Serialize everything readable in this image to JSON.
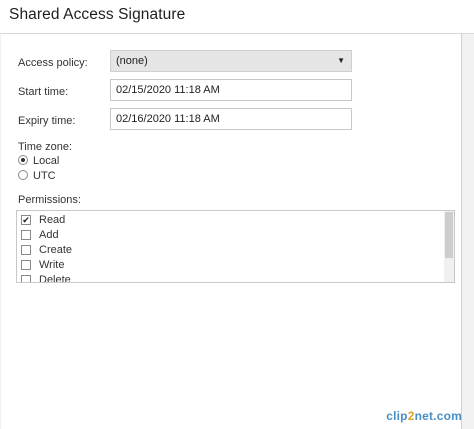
{
  "title": "Shared Access Signature",
  "form": {
    "access_policy_label": "Access policy:",
    "access_policy_value": "(none)",
    "start_time_label": "Start time:",
    "start_time_value": "02/15/2020 11:18  AM",
    "expiry_time_label": "Expiry time:",
    "expiry_time_value": "02/16/2020 11:18  AM",
    "time_zone_label": "Time zone:",
    "time_zone_options": [
      {
        "label": "Local",
        "selected": true
      },
      {
        "label": "UTC",
        "selected": false
      }
    ],
    "permissions_label": "Permissions:",
    "permissions": [
      {
        "label": "Read",
        "checked": true
      },
      {
        "label": "Add",
        "checked": false
      },
      {
        "label": "Create",
        "checked": false
      },
      {
        "label": "Write",
        "checked": false
      },
      {
        "label": "Delete",
        "checked": false
      }
    ]
  },
  "watermark": {
    "a": "clip",
    "b": "2",
    "c": "net.com"
  },
  "icons": {
    "dropdown": "chevron-down-icon",
    "check": "checkmark-icon"
  }
}
